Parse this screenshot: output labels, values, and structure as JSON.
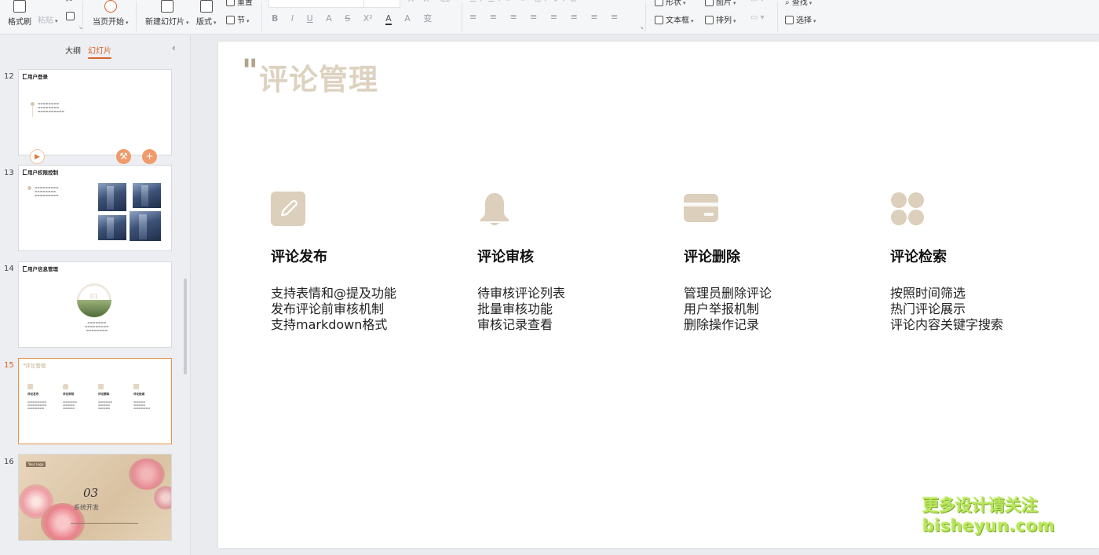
{
  "ribbon": {
    "format_painter": "格式刷",
    "paste": "粘贴",
    "from_current": "当页开始",
    "new_slide": "新建幻灯片",
    "layout": "版式",
    "section": "节",
    "reset": "重置",
    "shape": "形状",
    "picture": "图片",
    "textbox": "文本框",
    "arrange": "排列",
    "find": "查找",
    "select": "选择",
    "format_buttons": [
      "B",
      "I",
      "U",
      "A",
      "S",
      "X²",
      "A",
      "A",
      "变"
    ],
    "para_buttons": [
      "≡",
      "≡",
      "≡",
      "≡",
      "≡",
      "≡",
      "≡",
      "≡"
    ]
  },
  "panel": {
    "tab_outline": "大纲",
    "tab_slides": "幻灯片",
    "slides": [
      {
        "num": "12",
        "title": "用户登录"
      },
      {
        "num": "13",
        "title": "用户权限控制"
      },
      {
        "num": "14",
        "title": "用户信息管理",
        "badge": "01"
      },
      {
        "num": "15",
        "title": "评论管理",
        "cols": [
          {
            "title": "评论发布"
          },
          {
            "title": "评论审核"
          },
          {
            "title": "评论删除"
          },
          {
            "title": "评论检索"
          }
        ]
      },
      {
        "num": "16",
        "tag": "Your Logo",
        "big": "03",
        "sub": "系统开发"
      }
    ]
  },
  "slide": {
    "title": "评论管理",
    "features": [
      {
        "title": "评论发布",
        "lines": [
          "支持表情和@提及功能",
          "发布评论前审核机制",
          "支持markdown格式"
        ]
      },
      {
        "title": "评论审核",
        "lines": [
          "待审核评论列表",
          "批量审核功能",
          "审核记录查看"
        ]
      },
      {
        "title": "评论删除",
        "lines": [
          "管理员删除评论",
          "用户举报机制",
          "删除操作记录"
        ]
      },
      {
        "title": "评论检索",
        "lines": [
          "按照时间筛选",
          "热门评论展示",
          "评论内容关键字搜索"
        ]
      }
    ]
  },
  "watermark": {
    "line1": "更多设计请关注",
    "line2": "bisheyun.com"
  },
  "colors": {
    "accent": "#d9632a",
    "beige": "#ddd2c0",
    "icon": "#dccfbb"
  }
}
